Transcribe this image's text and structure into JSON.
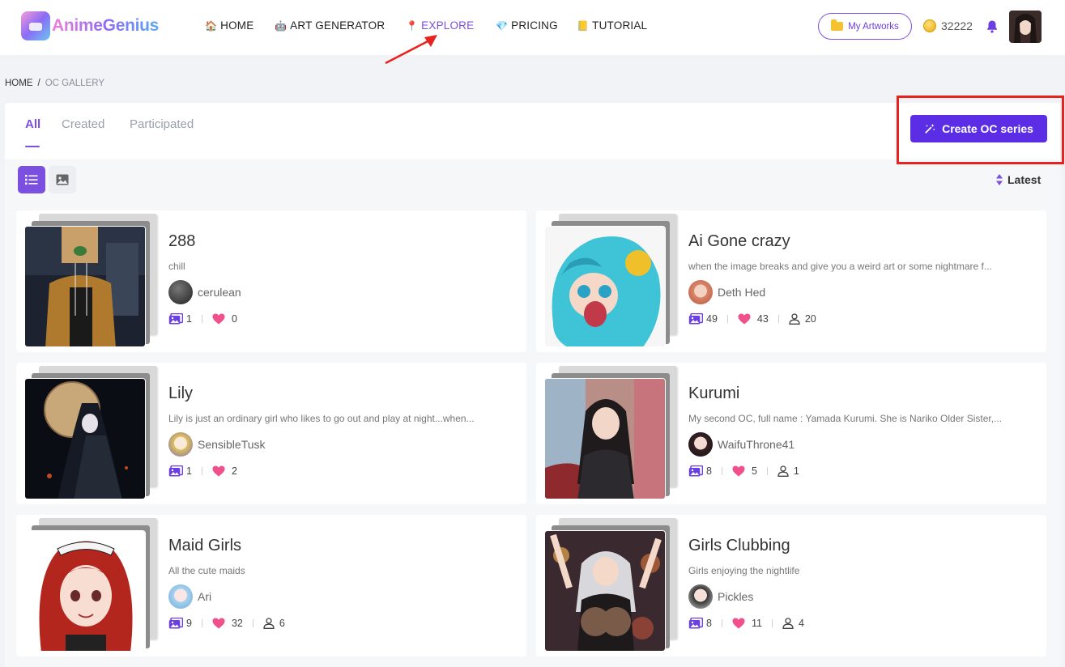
{
  "brand": {
    "name": "AnimeGenius",
    "logo_icon": "anime-cube-logo"
  },
  "nav": [
    {
      "label": "HOME",
      "icon": "house-icon"
    },
    {
      "label": "ART GENERATOR",
      "icon": "robot-icon"
    },
    {
      "label": "EXPLORE",
      "icon": "pin-icon",
      "active": true
    },
    {
      "label": "PRICING",
      "icon": "diamond-icon"
    },
    {
      "label": "TUTORIAL",
      "icon": "book-icon"
    }
  ],
  "header": {
    "my_artworks": "My Artworks",
    "coins": "32222"
  },
  "breadcrumb": {
    "home": "HOME",
    "sep": "/",
    "current": "OC GALLERY"
  },
  "tabs": [
    "All",
    "Created",
    "Participated"
  ],
  "create_button": "Create OC series",
  "sort": {
    "label": "Latest"
  },
  "colors": {
    "accent": "#7b4fe0",
    "button": "#5b2ee6",
    "annotation": "#e8231f",
    "heart": "#f0508c"
  },
  "cards": [
    {
      "title": "288",
      "desc": "chill",
      "author": "cerulean",
      "images": "1",
      "likes": "0",
      "members": null
    },
    {
      "title": "Ai Gone crazy",
      "desc": "when the image breaks and give you a weird art or some nightmare f...",
      "author": "Deth Hed",
      "images": "49",
      "likes": "43",
      "members": "20"
    },
    {
      "title": "Lily",
      "desc": "Lily is just an ordinary girl who likes to go out and play at night...when...",
      "author": "SensibleTusk",
      "images": "1",
      "likes": "2",
      "members": null
    },
    {
      "title": "Kurumi",
      "desc": "My second OC, full name : Yamada Kurumi. She is Nariko Older Sister,...",
      "author": "WaifuThrone41",
      "images": "8",
      "likes": "5",
      "members": "1"
    },
    {
      "title": "Maid Girls",
      "desc": "All the cute maids",
      "author": "Ari",
      "images": "9",
      "likes": "32",
      "members": "6"
    },
    {
      "title": "Girls Clubbing",
      "desc": "Girls enjoying the nightlife",
      "author": "Pickles",
      "images": "8",
      "likes": "11",
      "members": "4"
    }
  ]
}
